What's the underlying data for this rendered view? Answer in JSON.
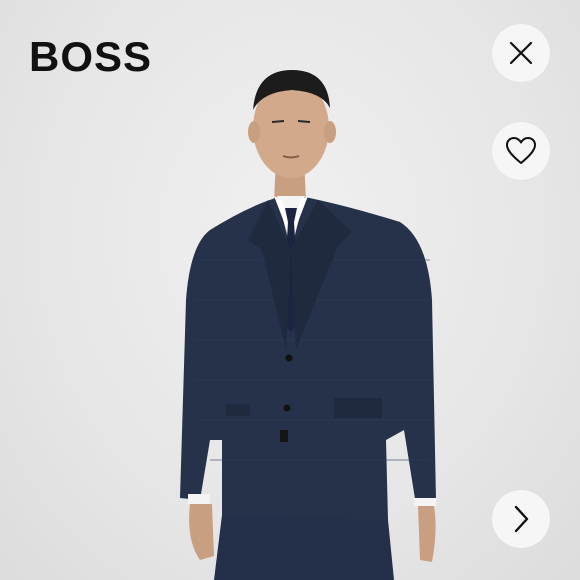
{
  "brand": {
    "logo_text": "BOSS"
  },
  "controls": {
    "close_icon": "close-icon",
    "favorite_icon": "heart-icon",
    "next_icon": "chevron-right-icon"
  },
  "colors": {
    "suit": "#25324a",
    "background": "#e9e9e9",
    "button_bg": "#f6f6f6"
  }
}
